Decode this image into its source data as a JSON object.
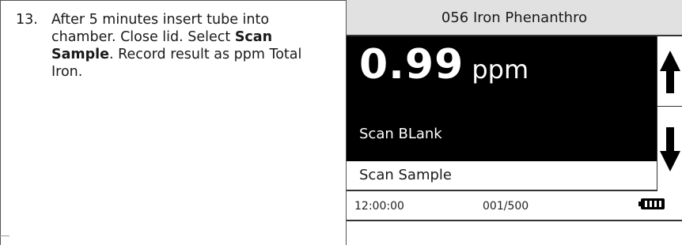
{
  "instruction": {
    "number": "13.",
    "text_1": "After 5 minutes insert tube into chamber. Close lid. Select ",
    "bold_1": "Scan Sample",
    "text_2": ". Record result as ppm Total Iron."
  },
  "meter": {
    "title": "056 Iron Phenanthro",
    "reading_value": "0.99",
    "reading_unit": "ppm",
    "menu_items": [
      "Scan BLank",
      "Scan Sample"
    ],
    "selected_item": "Scan BLank",
    "status": {
      "time": "12:00:00",
      "count": "001/500"
    },
    "icons": {
      "up": "arrow-up-icon",
      "down": "arrow-down-icon",
      "battery": "battery-icon"
    },
    "colors": {
      "title_bg": "#e1e1e1",
      "panel_bg": "#000000",
      "text_on_panel": "#ffffff"
    }
  }
}
